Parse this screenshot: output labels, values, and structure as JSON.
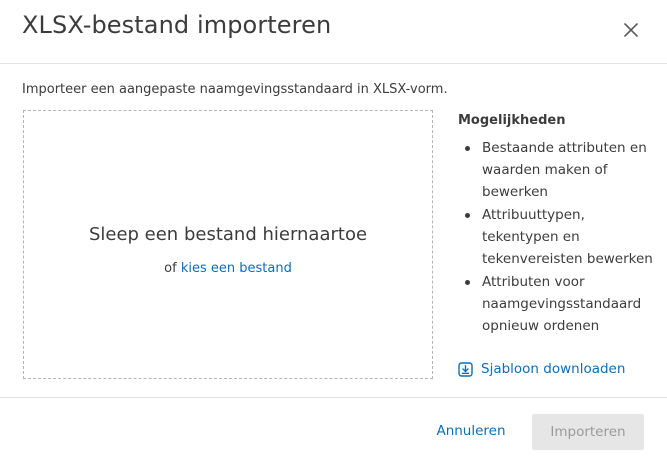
{
  "dialog": {
    "title": "XLSX-bestand importeren",
    "description": "Importeer een aangepaste naamgevingsstandaard in XLSX-vorm."
  },
  "dropzone": {
    "title": "Sleep een bestand hiernaartoe",
    "or_text": "of",
    "choose_link": "kies een bestand"
  },
  "options": {
    "heading": "Mogelijkheden",
    "items": [
      "Bestaande attributen en waarden maken of bewerken",
      "Attribuuttypen, tekentypen en tekenvereisten bewerken",
      "Attributen voor naamgevingsstandaard opnieuw ordenen"
    ],
    "download_label": "Sjabloon downloaden"
  },
  "footer": {
    "cancel_label": "Annuleren",
    "import_label": "Importeren"
  },
  "icons": {
    "close": "close-icon",
    "download": "download-icon"
  },
  "colors": {
    "link": "#0a6fb5",
    "text": "#3c3c3c",
    "disabled_bg": "#e6e6e6",
    "disabled_text": "#9a9a9a"
  }
}
